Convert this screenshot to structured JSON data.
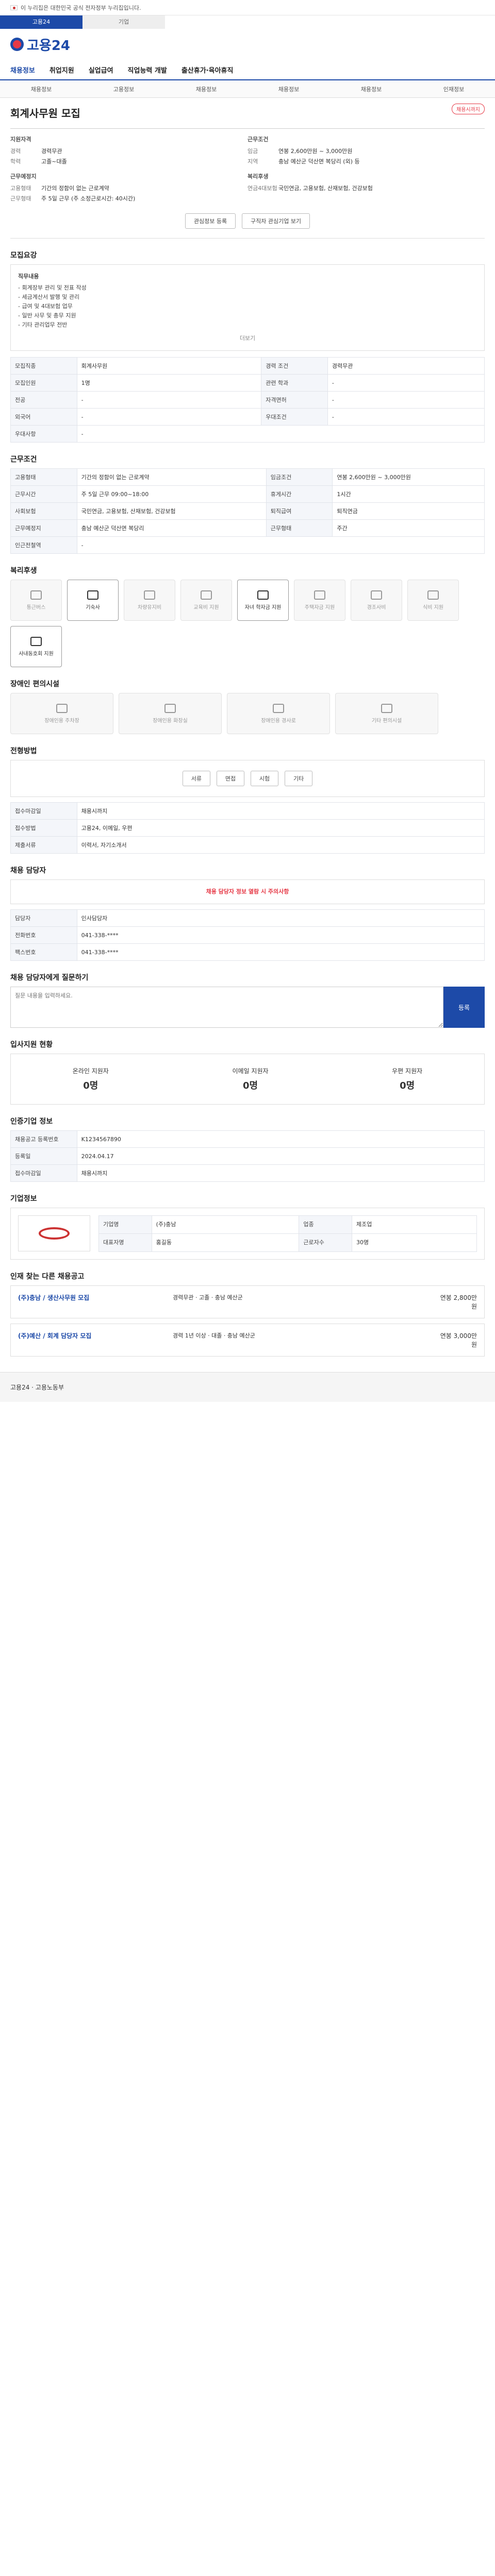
{
  "gov_notice": "이 누리집은 대한민국 공식 전자정부 누리집입니다.",
  "tabs": {
    "a": "고용24",
    "b": "기업"
  },
  "logo_text": "고용24",
  "gnb": [
    "채용정보",
    "취업지원",
    "실업급여",
    "직업능력 개발",
    "출산휴가·육아휴직"
  ],
  "sub": [
    "채용정보",
    "고용정보",
    "채용정보",
    "채용정보",
    "채용정보",
    "인재정보"
  ],
  "job_title": "회계사무원 모집",
  "status_badge": "채용시까지",
  "summary": {
    "left_h": "지원자격",
    "left_rows": [
      [
        "경력",
        "경력무관"
      ],
      [
        "학력",
        "고졸~대졸"
      ]
    ],
    "left_h2": "근무예정지",
    "left_rows2": [
      [
        "고용형태",
        "기간의 정함이 없는 근로계약"
      ],
      [
        "근무형태",
        "주 5일 근무 (주 소정근로시간: 40시간)"
      ]
    ],
    "right_h": "근무조건",
    "right_rows": [
      [
        "임금",
        "연봉 2,600만원 ~ 3,000만원"
      ],
      [
        "지역",
        "충남 예산군 덕산면 복당리 (외) 등"
      ]
    ],
    "right_h2": "복리후생",
    "right_rows2": [
      [
        "연금4대보험",
        "국민연금, 고용보험, 산재보험, 건강보험"
      ]
    ]
  },
  "buttons": {
    "like": "관심정보 등록",
    "print": "구직자 관심기업 보기"
  },
  "sec_recruit": "모집요강",
  "job_desc_title": "직무내용",
  "job_desc": [
    "- 회계장부 관리 및 전표 작성",
    "- 세금계산서 발행 및 관리",
    "- 급여 및 4대보험 업무",
    "- 일반 사무 및 총무 지원",
    "- 기타 관리업무 전반"
  ],
  "more": "더보기",
  "table1": [
    [
      "모집직종",
      "회계사무원",
      "경력 조건",
      "경력무관"
    ],
    [
      "모집인원",
      "1명",
      "관련 학과",
      "-"
    ],
    [
      "전공",
      "-",
      "자격면허",
      "-"
    ],
    [
      "외국어",
      "-",
      "우대조건",
      "-"
    ],
    [
      "우대사항",
      "-",
      "",
      "-"
    ]
  ],
  "sec_cond": "근무조건",
  "table2": [
    [
      "고용형태",
      "기간의 정함이 없는 근로계약",
      "임금조건",
      "연봉 2,600만원 ~ 3,000만원"
    ],
    [
      "근무시간",
      "주 5일 근무 09:00~18:00",
      "휴게시간",
      "1시간"
    ],
    [
      "사회보험",
      "국민연금, 고용보험, 산재보험, 건강보험",
      "퇴직급여",
      "퇴직연금"
    ],
    [
      "근무예정지",
      "충남 예산군 덕산면 복당리",
      "근무형태",
      "주간"
    ],
    [
      "인근전철역",
      "-",
      "",
      ""
    ]
  ],
  "sec_welfare": "복리후생",
  "welfare_icons": [
    "통근버스",
    "기숙사",
    "차량유지비",
    "교육비 지원",
    "자녀 학자금 지원",
    "주택자금 지원",
    "경조사비",
    "식비 지원",
    "사내동호회 지원"
  ],
  "sec_disabled": "장애인 편의시설",
  "disabled_icons": [
    "장애인용 주차장",
    "장애인용 화장실",
    "장애인용 경사로",
    "기타 편의시설"
  ],
  "sec_apply": "전형방법",
  "apply_btns": [
    "서류",
    "면접",
    "시험",
    "기타"
  ],
  "apply_rows": [
    [
      "접수마감일",
      "채용시까지"
    ],
    [
      "접수방법",
      "고용24, 이메일, 우편"
    ],
    [
      "제출서류",
      "이력서, 자기소개서"
    ]
  ],
  "sec_contact": "채용 담당자",
  "contact_notice": "채용 담당자 정보 열람 시 주의사항",
  "contact_rows": [
    [
      "담당자",
      "인사담당자"
    ],
    [
      "전화번호",
      "041-338-****"
    ],
    [
      "팩스번호",
      "041-338-****"
    ]
  ],
  "sec_question": "채용 담당자에게 질문하기",
  "question_placeholder": "질문 내용을 입력하세요.",
  "question_btn": "등록",
  "sec_status": "입사지원 현황",
  "status_items": [
    [
      "온라인 지원자",
      "0명"
    ],
    [
      "이메일 지원자",
      "0명"
    ],
    [
      "우편 지원자",
      "0명"
    ]
  ],
  "sec_info": "인증기업 정보",
  "info_rows": [
    [
      "채용공고 등록번호",
      "K1234567890"
    ],
    [
      "등록일",
      "2024.04.17"
    ],
    [
      "접수마감일",
      "채용시까지"
    ]
  ],
  "sec_company": "기업정보",
  "company_rows": [
    [
      "기업명",
      "(주)충남"
    ],
    [
      "업종",
      "제조업"
    ],
    [
      "대표자명",
      "홍길동"
    ],
    [
      "근로자수",
      "30명"
    ]
  ],
  "sec_similar": "인재 찾는 다른 채용공고",
  "similar": [
    {
      "title": "(주)충남 / 생산사무원 모집",
      "cond": "경력무관 · 고졸 · 충남 예산군",
      "pay": "연봉 2,800만원"
    },
    {
      "title": "(주)예산 / 회계 담당자 모집",
      "cond": "경력 1년 이상 · 대졸 · 충남 예산군",
      "pay": "연봉 3,000만원"
    }
  ],
  "footer": "고용24 · 고용노동부"
}
